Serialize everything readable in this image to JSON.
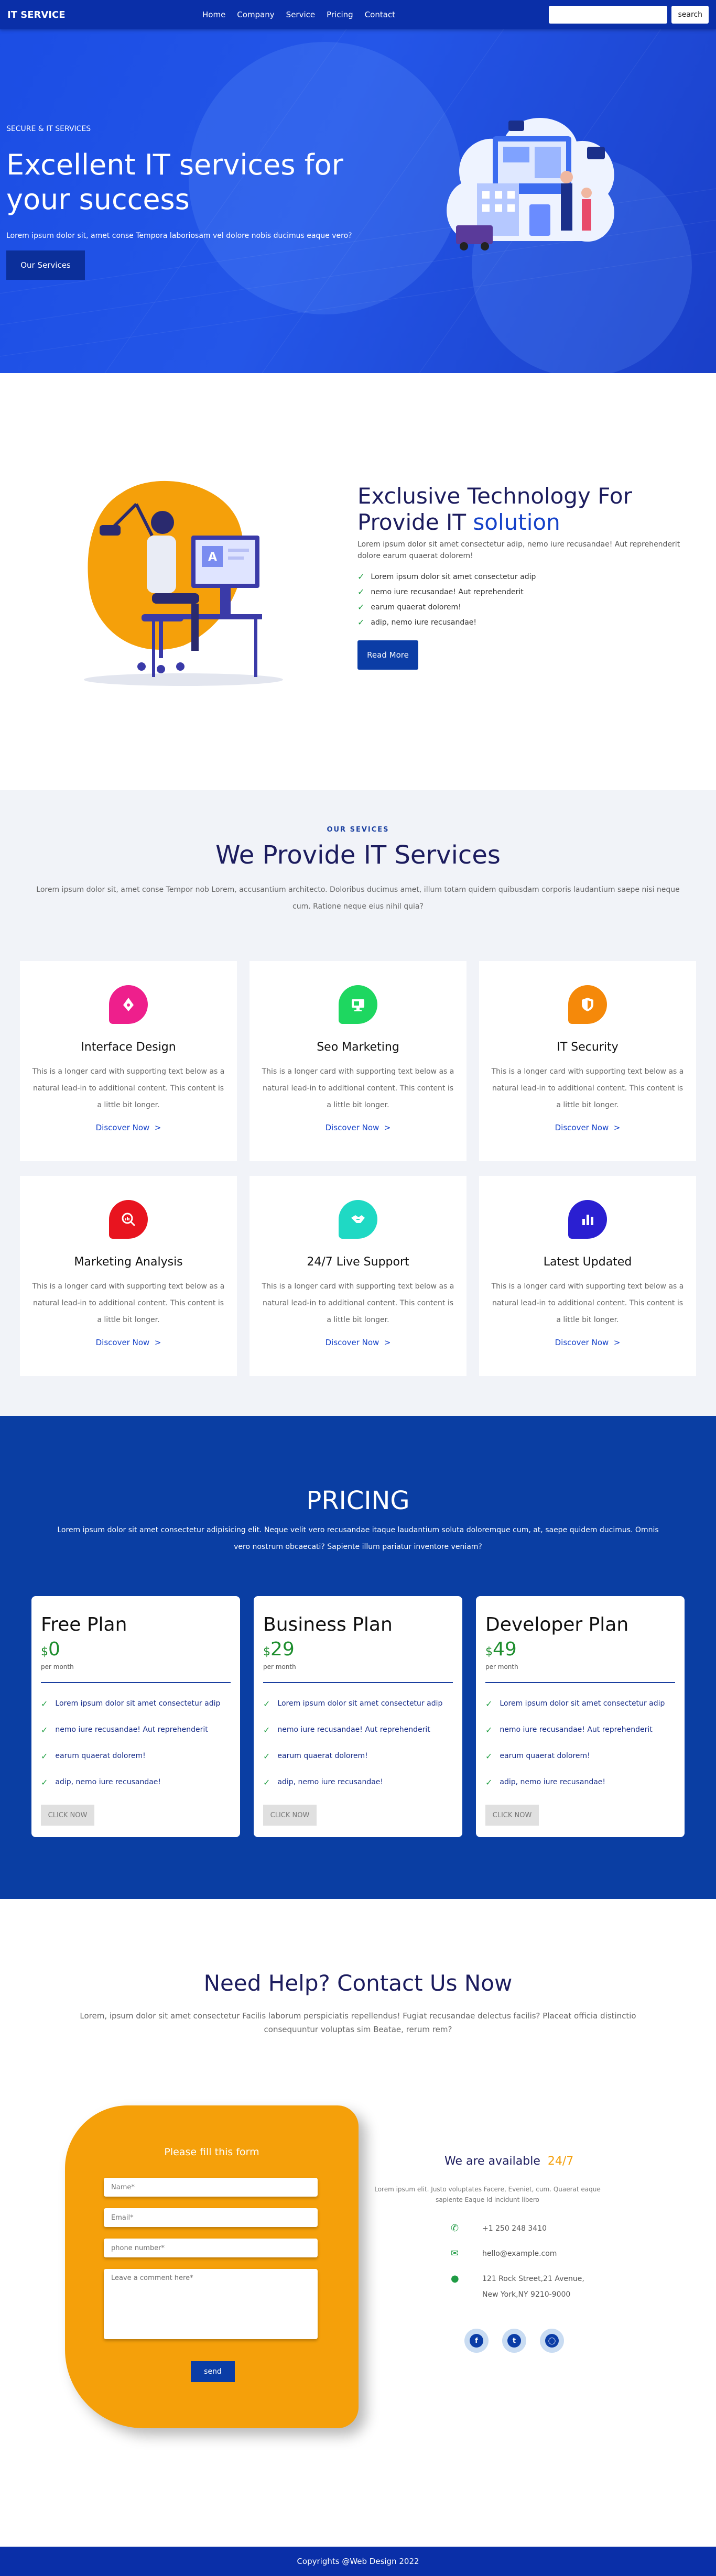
{
  "nav": {
    "brand": "IT SERVICE",
    "links": [
      "Home",
      "Company",
      "Service",
      "Pricing",
      "Contact"
    ],
    "search_placeholder": "",
    "search_button": "search"
  },
  "hero": {
    "kicker": "SECURE & IT SERVICES",
    "title": "Excellent IT services for your success",
    "text": "Lorem ipsum dolor sit, amet conse Tempora laboriosam vel dolore nobis ducimus eaque vero?",
    "button": "Our Services"
  },
  "about": {
    "title_part1": "Exclusive Technology For Provide IT",
    "title_highlight": "solution",
    "desc": "Lorem ipsum dolor sit amet consectetur adip, nemo iure recusandae! Aut reprehenderit dolore earum quaerat dolorem!",
    "checks": [
      "Lorem ipsum dolor sit amet consectetur adip",
      "nemo iure recusandae! Aut reprehenderit",
      "earum quaerat dolorem!",
      "adip, nemo iure recusandae!"
    ],
    "button": "Read More"
  },
  "services": {
    "kicker": "OUR SEVICES",
    "title": "We Provide IT Services",
    "desc": "Lorem ipsum dolor sit, amet conse Tempor nob Lorem, accusantium architecto. Doloribus ducimus amet, illum totam quidem quibusdam corporis laudantium saepe nisi neque cum. Ratione neque eius nihil quia?",
    "card_text": "This is a longer card with supporting text below as a natural lead-in to additional content. This content is a little bit longer.",
    "link": "Discover Now",
    "cards": [
      {
        "title": "Interface Design",
        "icon": "pen-tool-icon",
        "color": "#ee1f8c"
      },
      {
        "title": "Seo Marketing",
        "icon": "monitor-icon",
        "color": "#1ed760"
      },
      {
        "title": "IT Security",
        "icon": "shield-icon",
        "color": "#f5890a"
      },
      {
        "title": "Marketing Analysis",
        "icon": "magnifier-chart-icon",
        "color": "#e8141f"
      },
      {
        "title": "24/7 Live Support",
        "icon": "handshake-icon",
        "color": "#1fd9c4"
      },
      {
        "title": "Latest Updated",
        "icon": "bar-chart-icon",
        "color": "#2a1fd1"
      }
    ]
  },
  "pricing": {
    "title": "PRICING",
    "desc": "Lorem ipsum dolor sit amet consectetur adipisicing elit. Neque velit vero recusandae itaque laudantium soluta doloremque cum, at, saepe quidem ducimus. Omnis vero nostrum obcaecati? Sapiente illum pariatur inventore veniam?",
    "currency": "$",
    "per": "per month",
    "button": "CLICK NOW",
    "features": [
      "Lorem ipsum dolor sit amet consectetur adip",
      "nemo iure recusandae! Aut reprehenderit",
      "earum quaerat dolorem!",
      "adip, nemo iure recusandae!"
    ],
    "plans": [
      {
        "name": "Free Plan",
        "price": "0"
      },
      {
        "name": "Business Plan",
        "price": "29"
      },
      {
        "name": "Developer Plan",
        "price": "49"
      }
    ]
  },
  "contact": {
    "title": "Need Help? Contact Us Now",
    "desc": "Lorem, ipsum dolor sit amet consectetur Facilis laborum perspiciatis repellendus! Fugiat recusandae delectus facilis? Placeat officia distinctio consequuntur voluptas sim Beatae, rerum rem?",
    "form_title": "Please fill this form",
    "name_placeholder": "Name*",
    "email_placeholder": "Email*",
    "phone_placeholder": "phone number*",
    "comment_placeholder": "Leave a comment here*",
    "send": "send",
    "available": "We are available",
    "available_hl": "24/7",
    "info_desc": "Lorem ipsum elit. Justo voluptates Facere, Eveniet, cum. Quaerat eaque sapiente Eaque Id incidunt libero",
    "phone": "+1 250 248 3410",
    "email": "hello@example.com",
    "address_line1": "121 Rock Street,21 Avenue,",
    "address_line2": "New York,NY 9210-9000"
  },
  "footer": {
    "text": "Copyrights @Web Design 2022"
  }
}
